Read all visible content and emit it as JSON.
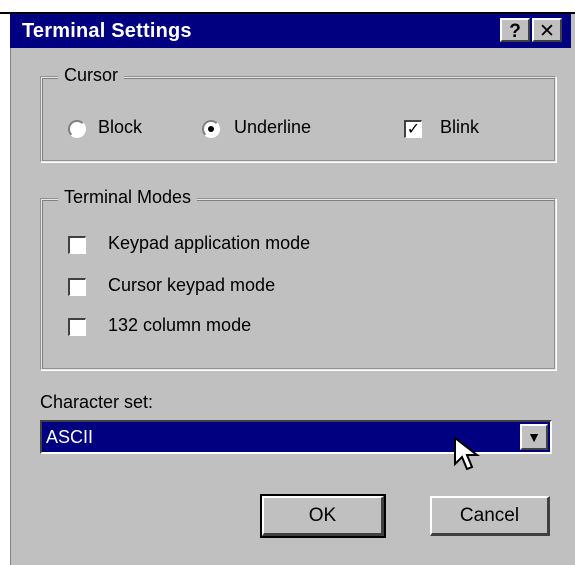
{
  "window": {
    "title": "Terminal Settings",
    "help_glyph": "?",
    "close_glyph": "✕"
  },
  "cursor_group": {
    "label": "Cursor",
    "options": [
      {
        "label": "Block",
        "checked": false
      },
      {
        "label": "Underline",
        "checked": true
      }
    ],
    "blink": {
      "label": "Blink",
      "checked": true
    }
  },
  "terminal_modes_group": {
    "label": "Terminal Modes",
    "items": [
      {
        "label": "Keypad application mode",
        "checked": false
      },
      {
        "label": "Cursor keypad mode",
        "checked": false
      },
      {
        "label": "132 column mode",
        "checked": false
      }
    ]
  },
  "character_set": {
    "label": "Character set:",
    "selected": "ASCII"
  },
  "buttons": {
    "ok": "OK",
    "cancel": "Cancel"
  },
  "colors": {
    "titlebar": "#000080",
    "dialog_face": "#c0c0c0",
    "selection": "#000080"
  }
}
